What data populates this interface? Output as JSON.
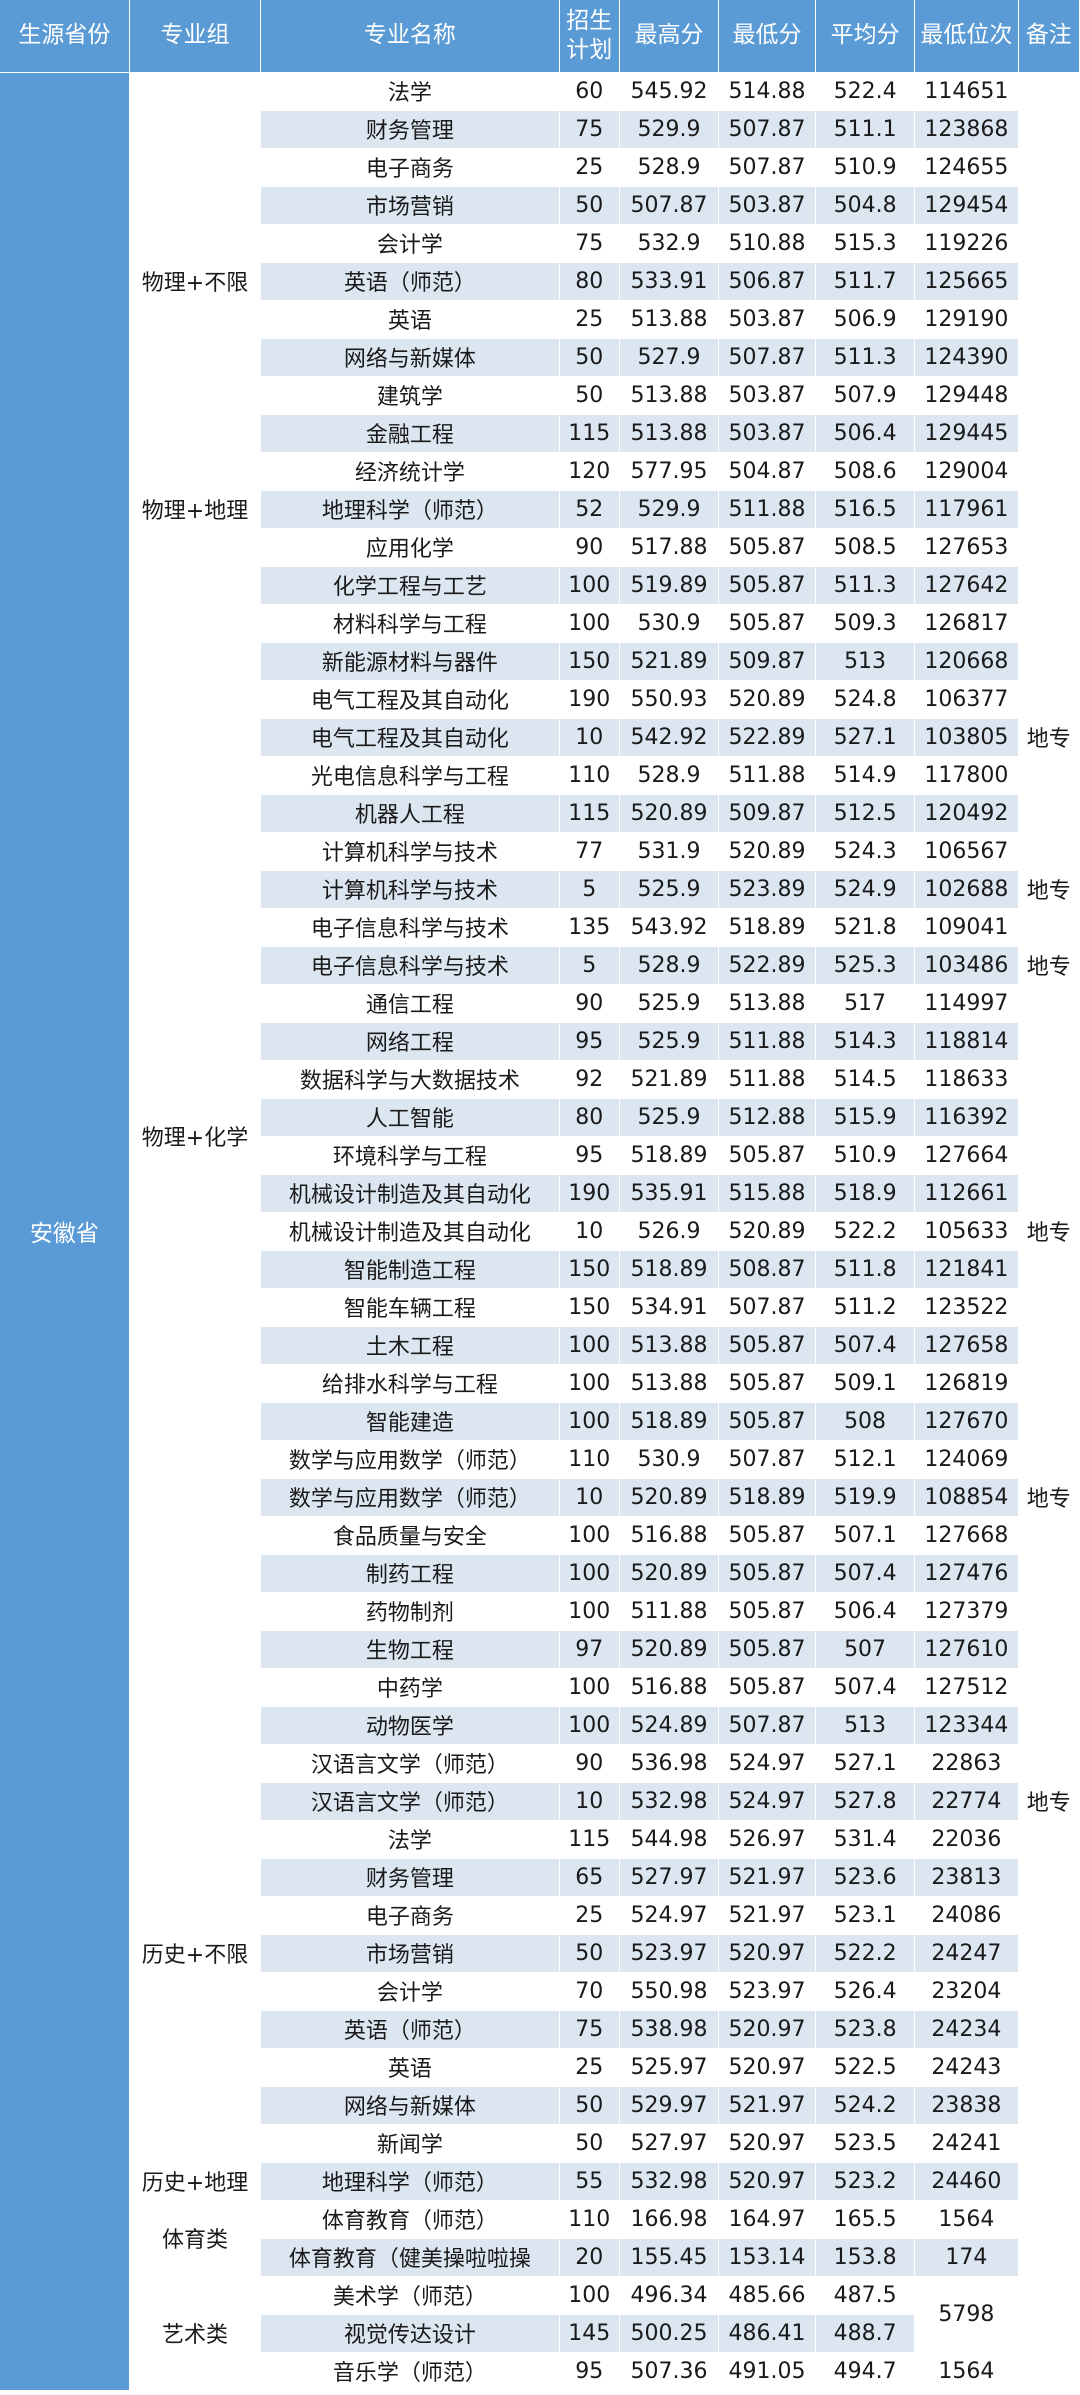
{
  "headers": {
    "province": "生源省份",
    "group": "专业组",
    "major": "专业名称",
    "plan": "招生\n计划",
    "max": "最高分",
    "min": "最低分",
    "avg": "平均分",
    "rank": "最低位次",
    "note": "备注"
  },
  "province": "安徽省",
  "groups": {
    "g1": "物理+不限",
    "g2": "物理+地理",
    "g3": "物理+化学",
    "g4": "历史+不限",
    "g5": "历史+地理",
    "g6": "体育类",
    "g7": "艺术类"
  },
  "rows": [
    {
      "name": "法学",
      "plan": "60",
      "max": "545.92",
      "min": "514.88",
      "avg": "522.4",
      "rank": "114651",
      "note": ""
    },
    {
      "name": "财务管理",
      "plan": "75",
      "max": "529.9",
      "min": "507.87",
      "avg": "511.1",
      "rank": "123868",
      "note": ""
    },
    {
      "name": "电子商务",
      "plan": "25",
      "max": "528.9",
      "min": "507.87",
      "avg": "510.9",
      "rank": "124655",
      "note": ""
    },
    {
      "name": "市场营销",
      "plan": "50",
      "max": "507.87",
      "min": "503.87",
      "avg": "504.8",
      "rank": "129454",
      "note": ""
    },
    {
      "name": "会计学",
      "plan": "75",
      "max": "532.9",
      "min": "510.88",
      "avg": "515.3",
      "rank": "119226",
      "note": ""
    },
    {
      "name": "英语（师范）",
      "plan": "80",
      "max": "533.91",
      "min": "506.87",
      "avg": "511.7",
      "rank": "125665",
      "note": ""
    },
    {
      "name": "英语",
      "plan": "25",
      "max": "513.88",
      "min": "503.87",
      "avg": "506.9",
      "rank": "129190",
      "note": ""
    },
    {
      "name": "网络与新媒体",
      "plan": "50",
      "max": "527.9",
      "min": "507.87",
      "avg": "511.3",
      "rank": "124390",
      "note": ""
    },
    {
      "name": "建筑学",
      "plan": "50",
      "max": "513.88",
      "min": "503.87",
      "avg": "507.9",
      "rank": "129448",
      "note": ""
    },
    {
      "name": "金融工程",
      "plan": "115",
      "max": "513.88",
      "min": "503.87",
      "avg": "506.4",
      "rank": "129445",
      "note": ""
    },
    {
      "name": "经济统计学",
      "plan": "120",
      "max": "577.95",
      "min": "504.87",
      "avg": "508.6",
      "rank": "129004",
      "note": ""
    },
    {
      "name": "地理科学（师范）",
      "plan": "52",
      "max": "529.9",
      "min": "511.88",
      "avg": "516.5",
      "rank": "117961",
      "note": ""
    },
    {
      "name": "应用化学",
      "plan": "90",
      "max": "517.88",
      "min": "505.87",
      "avg": "508.5",
      "rank": "127653",
      "note": ""
    },
    {
      "name": "化学工程与工艺",
      "plan": "100",
      "max": "519.89",
      "min": "505.87",
      "avg": "511.3",
      "rank": "127642",
      "note": ""
    },
    {
      "name": "材料科学与工程",
      "plan": "100",
      "max": "530.9",
      "min": "505.87",
      "avg": "509.3",
      "rank": "126817",
      "note": ""
    },
    {
      "name": "新能源材料与器件",
      "plan": "150",
      "max": "521.89",
      "min": "509.87",
      "avg": "513",
      "rank": "120668",
      "note": ""
    },
    {
      "name": "电气工程及其自动化",
      "plan": "190",
      "max": "550.93",
      "min": "520.89",
      "avg": "524.8",
      "rank": "106377",
      "note": ""
    },
    {
      "name": "电气工程及其自动化",
      "plan": "10",
      "max": "542.92",
      "min": "522.89",
      "avg": "527.1",
      "rank": "103805",
      "note": "地专"
    },
    {
      "name": "光电信息科学与工程",
      "plan": "110",
      "max": "528.9",
      "min": "511.88",
      "avg": "514.9",
      "rank": "117800",
      "note": ""
    },
    {
      "name": "机器人工程",
      "plan": "115",
      "max": "520.89",
      "min": "509.87",
      "avg": "512.5",
      "rank": "120492",
      "note": ""
    },
    {
      "name": "计算机科学与技术",
      "plan": "77",
      "max": "531.9",
      "min": "520.89",
      "avg": "524.3",
      "rank": "106567",
      "note": ""
    },
    {
      "name": "计算机科学与技术",
      "plan": "5",
      "max": "525.9",
      "min": "523.89",
      "avg": "524.9",
      "rank": "102688",
      "note": "地专"
    },
    {
      "name": "电子信息科学与技术",
      "plan": "135",
      "max": "543.92",
      "min": "518.89",
      "avg": "521.8",
      "rank": "109041",
      "note": ""
    },
    {
      "name": "电子信息科学与技术",
      "plan": "5",
      "max": "528.9",
      "min": "522.89",
      "avg": "525.3",
      "rank": "103486",
      "note": "地专"
    },
    {
      "name": "通信工程",
      "plan": "90",
      "max": "525.9",
      "min": "513.88",
      "avg": "517",
      "rank": "114997",
      "note": ""
    },
    {
      "name": "网络工程",
      "plan": "95",
      "max": "525.9",
      "min": "511.88",
      "avg": "514.3",
      "rank": "118814",
      "note": ""
    },
    {
      "name": "数据科学与大数据技术",
      "plan": "92",
      "max": "521.89",
      "min": "511.88",
      "avg": "514.5",
      "rank": "118633",
      "note": ""
    },
    {
      "name": "人工智能",
      "plan": "80",
      "max": "525.9",
      "min": "512.88",
      "avg": "515.9",
      "rank": "116392",
      "note": ""
    },
    {
      "name": "环境科学与工程",
      "plan": "95",
      "max": "518.89",
      "min": "505.87",
      "avg": "510.9",
      "rank": "127664",
      "note": ""
    },
    {
      "name": "机械设计制造及其自动化",
      "plan": "190",
      "max": "535.91",
      "min": "515.88",
      "avg": "518.9",
      "rank": "112661",
      "note": ""
    },
    {
      "name": "机械设计制造及其自动化",
      "plan": "10",
      "max": "526.9",
      "min": "520.89",
      "avg": "522.2",
      "rank": "105633",
      "note": "地专"
    },
    {
      "name": "智能制造工程",
      "plan": "150",
      "max": "518.89",
      "min": "508.87",
      "avg": "511.8",
      "rank": "121841",
      "note": ""
    },
    {
      "name": "智能车辆工程",
      "plan": "150",
      "max": "534.91",
      "min": "507.87",
      "avg": "511.2",
      "rank": "123522",
      "note": ""
    },
    {
      "name": "土木工程",
      "plan": "100",
      "max": "513.88",
      "min": "505.87",
      "avg": "507.4",
      "rank": "127658",
      "note": ""
    },
    {
      "name": "给排水科学与工程",
      "plan": "100",
      "max": "513.88",
      "min": "505.87",
      "avg": "509.1",
      "rank": "126819",
      "note": ""
    },
    {
      "name": "智能建造",
      "plan": "100",
      "max": "518.89",
      "min": "505.87",
      "avg": "508",
      "rank": "127670",
      "note": ""
    },
    {
      "name": "数学与应用数学（师范）",
      "plan": "110",
      "max": "530.9",
      "min": "507.87",
      "avg": "512.1",
      "rank": "124069",
      "note": ""
    },
    {
      "name": "数学与应用数学（师范）",
      "plan": "10",
      "max": "520.89",
      "min": "518.89",
      "avg": "519.9",
      "rank": "108854",
      "note": "地专"
    },
    {
      "name": "食品质量与安全",
      "plan": "100",
      "max": "516.88",
      "min": "505.87",
      "avg": "507.1",
      "rank": "127668",
      "note": ""
    },
    {
      "name": "制药工程",
      "plan": "100",
      "max": "520.89",
      "min": "505.87",
      "avg": "507.4",
      "rank": "127476",
      "note": ""
    },
    {
      "name": "药物制剂",
      "plan": "100",
      "max": "511.88",
      "min": "505.87",
      "avg": "506.4",
      "rank": "127379",
      "note": ""
    },
    {
      "name": "生物工程",
      "plan": "97",
      "max": "520.89",
      "min": "505.87",
      "avg": "507",
      "rank": "127610",
      "note": ""
    },
    {
      "name": "中药学",
      "plan": "100",
      "max": "516.88",
      "min": "505.87",
      "avg": "507.4",
      "rank": "127512",
      "note": ""
    },
    {
      "name": "动物医学",
      "plan": "100",
      "max": "524.89",
      "min": "507.87",
      "avg": "513",
      "rank": "123344",
      "note": ""
    },
    {
      "name": "汉语言文学（师范）",
      "plan": "90",
      "max": "536.98",
      "min": "524.97",
      "avg": "527.1",
      "rank": "22863",
      "note": ""
    },
    {
      "name": "汉语言文学（师范）",
      "plan": "10",
      "max": "532.98",
      "min": "524.97",
      "avg": "527.8",
      "rank": "22774",
      "note": "地专"
    },
    {
      "name": "法学",
      "plan": "115",
      "max": "544.98",
      "min": "526.97",
      "avg": "531.4",
      "rank": "22036",
      "note": ""
    },
    {
      "name": "财务管理",
      "plan": "65",
      "max": "527.97",
      "min": "521.97",
      "avg": "523.6",
      "rank": "23813",
      "note": ""
    },
    {
      "name": "电子商务",
      "plan": "25",
      "max": "524.97",
      "min": "521.97",
      "avg": "523.1",
      "rank": "24086",
      "note": ""
    },
    {
      "name": "市场营销",
      "plan": "50",
      "max": "523.97",
      "min": "520.97",
      "avg": "522.2",
      "rank": "24247",
      "note": ""
    },
    {
      "name": "会计学",
      "plan": "70",
      "max": "550.98",
      "min": "523.97",
      "avg": "526.4",
      "rank": "23204",
      "note": ""
    },
    {
      "name": "英语（师范）",
      "plan": "75",
      "max": "538.98",
      "min": "520.97",
      "avg": "523.8",
      "rank": "24234",
      "note": ""
    },
    {
      "name": "英语",
      "plan": "25",
      "max": "525.97",
      "min": "520.97",
      "avg": "522.5",
      "rank": "24243",
      "note": ""
    },
    {
      "name": "网络与新媒体",
      "plan": "50",
      "max": "529.97",
      "min": "521.97",
      "avg": "524.2",
      "rank": "23838",
      "note": ""
    },
    {
      "name": "新闻学",
      "plan": "50",
      "max": "527.97",
      "min": "520.97",
      "avg": "523.5",
      "rank": "24241",
      "note": ""
    },
    {
      "name": "地理科学（师范）",
      "plan": "55",
      "max": "532.98",
      "min": "520.97",
      "avg": "523.2",
      "rank": "24460",
      "note": ""
    },
    {
      "name": "体育教育（师范）",
      "plan": "110",
      "max": "166.98",
      "min": "164.97",
      "avg": "165.5",
      "rank": "1564",
      "note": ""
    },
    {
      "name": "体育教育（健美操啦啦操",
      "plan": "20",
      "max": "155.45",
      "min": "153.14",
      "avg": "153.8",
      "rank": "174",
      "note": ""
    },
    {
      "name": "美术学（师范）",
      "plan": "100",
      "max": "496.34",
      "min": "485.66",
      "avg": "487.5",
      "rank": "",
      "note": ""
    },
    {
      "name": "视觉传达设计",
      "plan": "145",
      "max": "500.25",
      "min": "486.41",
      "avg": "488.7",
      "rank": "",
      "note": ""
    },
    {
      "name": "音乐学（师范）",
      "plan": "95",
      "max": "507.36",
      "min": "491.05",
      "avg": "494.7",
      "rank": "1564",
      "note": ""
    }
  ],
  "art_merged_rank": "5798"
}
